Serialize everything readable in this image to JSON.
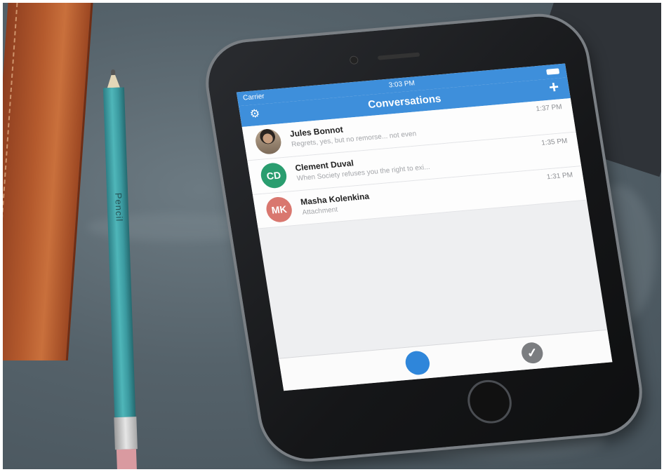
{
  "pencil": {
    "imprint": "Pencil"
  },
  "phone": {
    "status_bar": {
      "carrier": "Carrier",
      "time": "3:03 PM"
    },
    "nav": {
      "title": "Conversations",
      "left_icon": "gear-icon",
      "right_icon": "plus-icon",
      "right_label": "+"
    },
    "conversations": [
      {
        "name": "Jules Bonnot",
        "preview": "Regrets, yes, but no remorse... not even",
        "time": "1:37 PM",
        "avatar_initials": "",
        "avatar_type": "photo",
        "avatar_color": ""
      },
      {
        "name": "Clement Duval",
        "preview": "When Society refuses you the right to exi...",
        "time": "1:35 PM",
        "avatar_initials": "CD",
        "avatar_type": "initials",
        "avatar_color": "#2a9d6f"
      },
      {
        "name": "Masha Kolenkina",
        "preview": "Attachment",
        "time": "1:31 PM",
        "avatar_initials": "MK",
        "avatar_type": "initials",
        "avatar_color": "#d9776f"
      }
    ],
    "tab_bar": {
      "left_icon": "compose-dot-icon",
      "right_icon": "check-icon",
      "check_glyph": "✓"
    },
    "colors": {
      "accent": "#3e8fdb",
      "background": "#eeeff1"
    }
  }
}
